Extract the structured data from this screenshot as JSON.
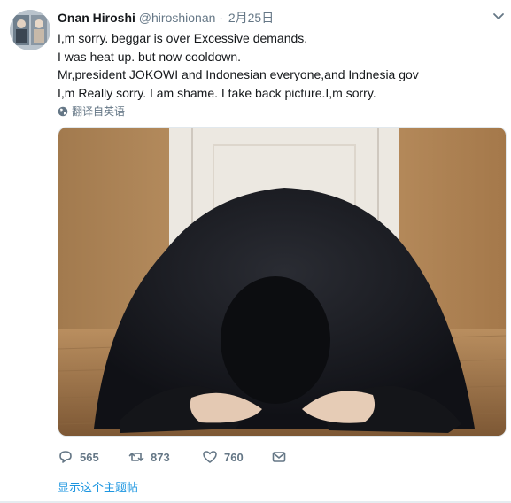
{
  "user": {
    "name": "Onan Hiroshi",
    "handle": "@hiroshionan",
    "separator": "·",
    "date": "2月25日"
  },
  "tweet_lines": [
    "I,m sorry. beggar is over Excessive demands.",
    "I was heat up. but now cooldown.",
    "Mr,president JOKOWI and Indonesian everyone,and Indnesia gov",
    "I,m Really sorry. I am shame. I take back picture.I,m sorry."
  ],
  "translate_label": "翻译自英语",
  "actions": {
    "reply_count": "565",
    "retweet_count": "873",
    "like_count": "760"
  },
  "show_thread_label": "显示这个主题帖",
  "icons": {
    "caret": "chevron-down-icon",
    "globe": "globe-icon",
    "reply": "reply-icon",
    "retweet": "retweet-icon",
    "like": "heart-icon",
    "dm": "envelope-icon"
  },
  "colors": {
    "link": "#1b95e0",
    "muted": "#657786",
    "text": "#14171a"
  }
}
